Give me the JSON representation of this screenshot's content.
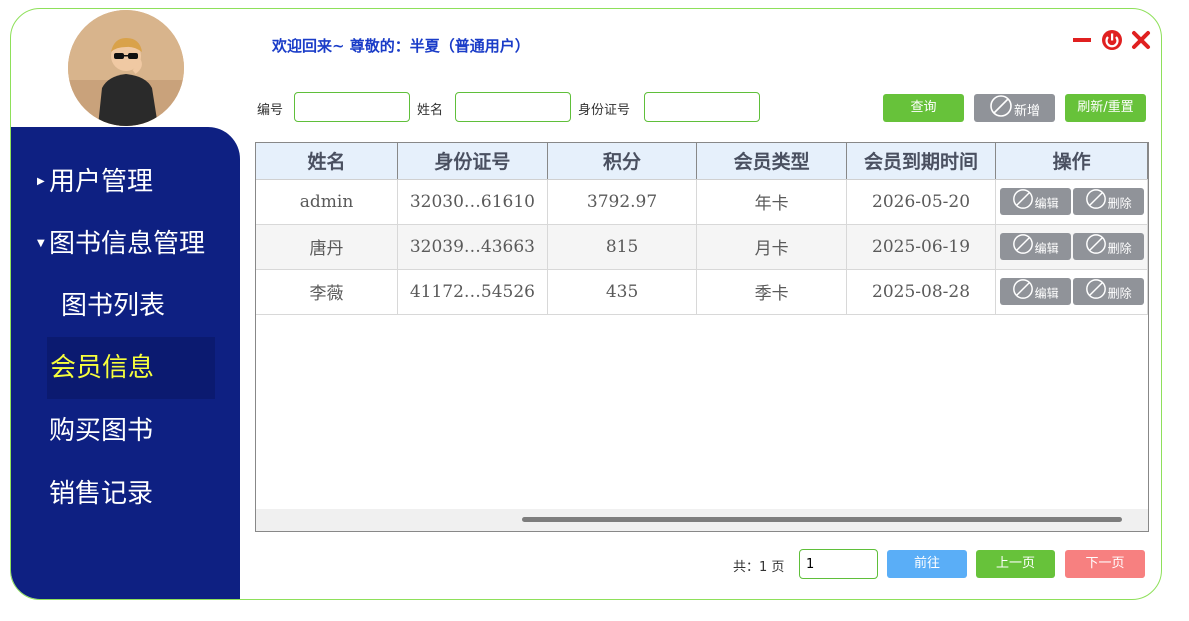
{
  "header": {
    "welcome": "欢迎回来~ 尊敬的：半夏（普通用户）",
    "minimize_icon": "minus-icon",
    "power_icon": "power-icon",
    "close_icon": "close-x-icon"
  },
  "sidebar": {
    "items": [
      {
        "label": "用户管理",
        "expandable": true,
        "expanded": false
      },
      {
        "label": "图书信息管理",
        "expandable": true,
        "expanded": true
      },
      {
        "label": "图书列表",
        "sub": true
      },
      {
        "label": "会员信息",
        "active": true
      },
      {
        "label": "购买图书"
      },
      {
        "label": "销售记录"
      }
    ],
    "bg_color": "#0e2082",
    "active_color": "#f7ff3c"
  },
  "filters": {
    "id_label": "编号",
    "id_value": "",
    "name_label": "姓名",
    "name_value": "",
    "idcard_label": "身份证号",
    "idcard_value": ""
  },
  "toolbar": {
    "query_label": "查询",
    "add_label": "新增",
    "refresh_label": "刷新/重置"
  },
  "table": {
    "columns": [
      "姓名",
      "身份证号",
      "积分",
      "会员类型",
      "会员到期时间",
      "操作"
    ],
    "rows": [
      {
        "name": "admin",
        "idcard": "32030…61610",
        "points": "3792.97",
        "type": "年卡",
        "expire": "2026-05-20"
      },
      {
        "name": "唐丹",
        "idcard": "32039…43663",
        "points": "815",
        "type": "月卡",
        "expire": "2025-06-19"
      },
      {
        "name": "李薇",
        "idcard": "41172…54526",
        "points": "435",
        "type": "季卡",
        "expire": "2025-08-28"
      }
    ],
    "edit_label": "编辑",
    "delete_label": "删除"
  },
  "pager": {
    "total_text": "共：1 页",
    "page_value": "1",
    "go_label": "前往",
    "prev_label": "上一页",
    "next_label": "下一页"
  }
}
